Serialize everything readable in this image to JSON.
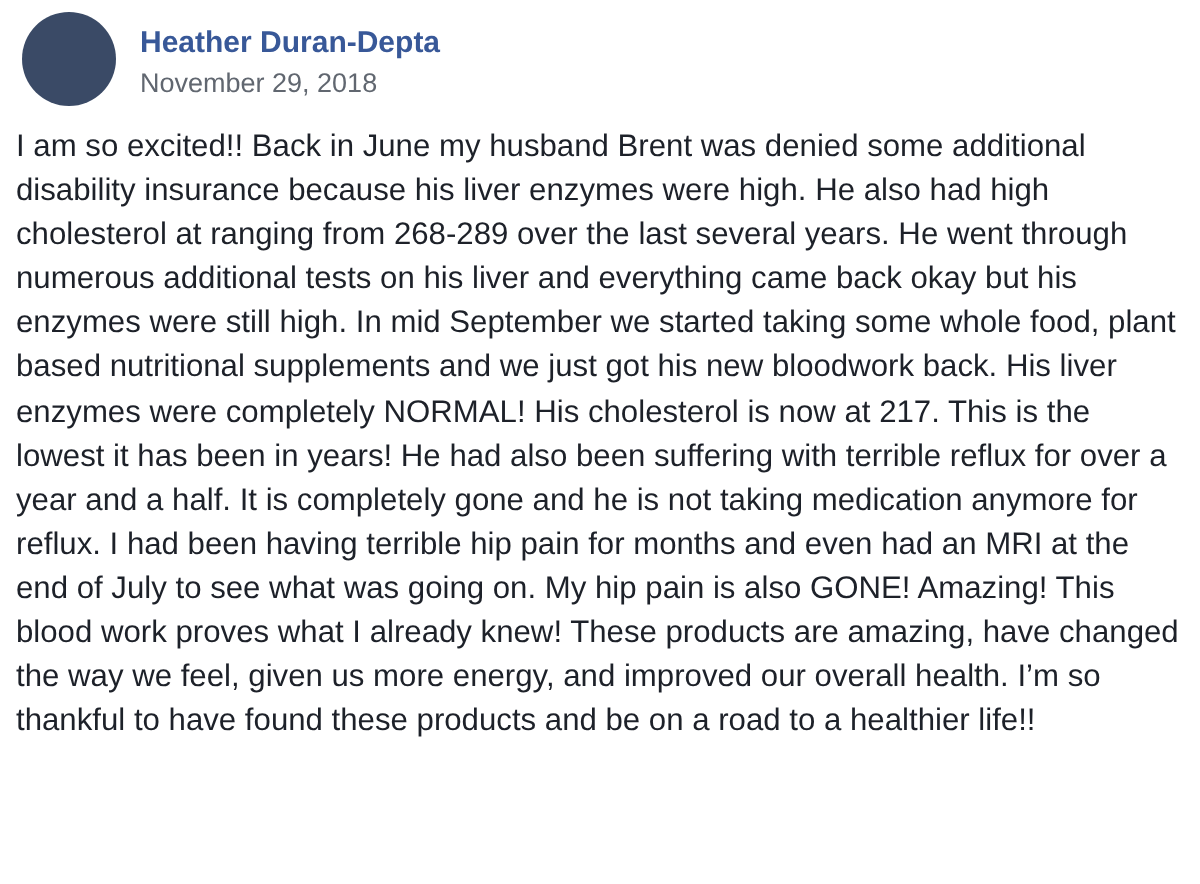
{
  "post": {
    "author": "Heather Duran-Depta",
    "date": "November 29, 2018",
    "text": "I am so excited!! Back in June my husband Brent was denied some additional disability insurance because his liver enzymes were high. He also had high cholesterol at ranging from 268-289 over the last several years. He went through numerous additional tests on his liver and everything came back okay but his enzymes were still high. In mid September we started taking some whole food, plant based nutritional supplements and we just got his new bloodwork back. His liver enzymes were completely NORMAL! His cholesterol is now at 217. This is the lowest it has been in years! He had also been suffering with terrible reflux for over a year and a half. It is completely gone and he is not taking medication anymore for reflux. I had been having terrible hip pain for months and even had an MRI at the end of July to see what was going on. My hip pain is also GONE! Amazing! This blood work proves what I already knew! These products are amazing, have changed the way we feel, given us more energy, and improved our overall health. I’m so thankful to have found these products and be on a road to a healthier life!!"
  }
}
